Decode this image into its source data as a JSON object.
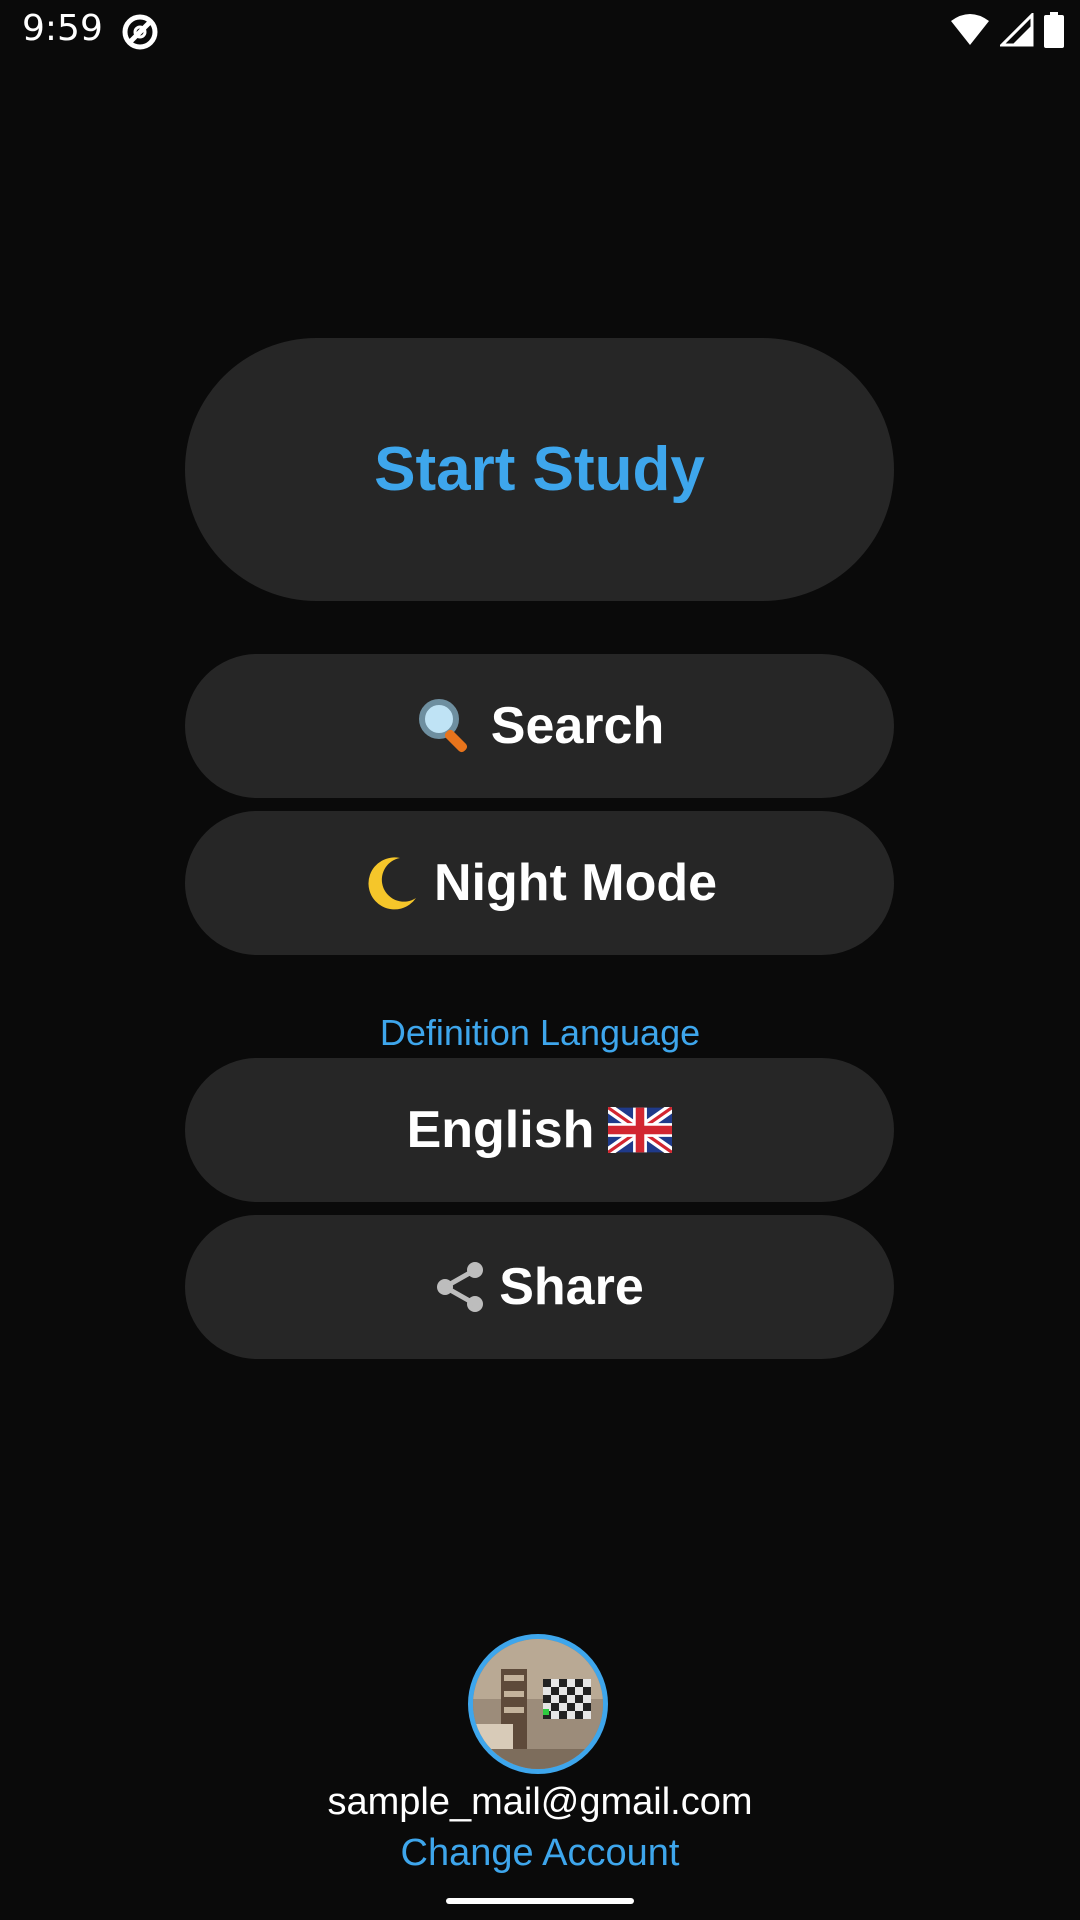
{
  "status_bar": {
    "time": "9:59"
  },
  "main": {
    "start_study_label": "Start Study",
    "search_label": "Search",
    "night_mode_label": "Night Mode",
    "definition_language_label": "Definition Language",
    "language_label": "English",
    "share_label": "Share"
  },
  "account": {
    "email": "sample_mail@gmail.com",
    "change_account_label": "Change Account"
  },
  "colors": {
    "accent": "#3ea6ec",
    "background": "#0a0a0a",
    "button_bg": "#262626"
  },
  "icons": {
    "search": "magnifying-glass-icon",
    "night_mode": "crescent-moon-icon",
    "language": "uk-flag-icon",
    "share": "share-icon"
  }
}
